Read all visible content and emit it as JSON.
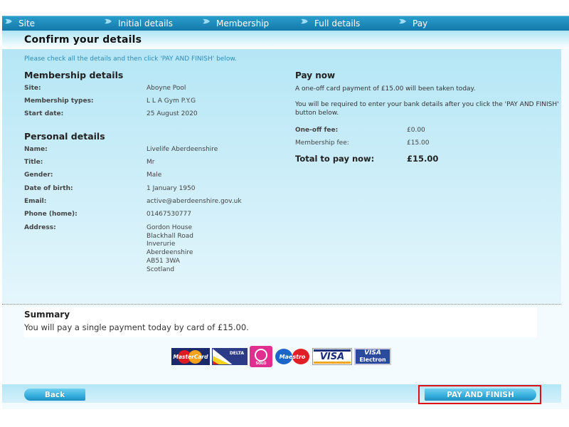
{
  "nav": {
    "steps": [
      {
        "label": "Site",
        "icon": "arrow-icon"
      },
      {
        "label": "Initial details",
        "icon": "arrow-icon"
      },
      {
        "label": "Membership",
        "icon": "arrow-icon"
      },
      {
        "label": "Full details",
        "icon": "arrow-icon"
      },
      {
        "label": "Pay",
        "icon": "arrow-icon"
      }
    ]
  },
  "page": {
    "title": "Confirm your details",
    "instruction": "Please check all the details and then click 'PAY AND FINISH' below."
  },
  "membership": {
    "heading": "Membership details",
    "rows": [
      {
        "label": "Site:",
        "value": "Aboyne Pool"
      },
      {
        "label": "Membership types:",
        "value": "L L A Gym P.Y.G"
      },
      {
        "label": "Start date:",
        "value": "25 August 2020"
      }
    ]
  },
  "personal": {
    "heading": "Personal details",
    "rows": [
      {
        "label": "Name:",
        "value": "Livelife Aberdeenshire"
      },
      {
        "label": "Title:",
        "value": "Mr"
      },
      {
        "label": "Gender:",
        "value": "Male"
      },
      {
        "label": "Date of birth:",
        "value": "1 January 1950"
      },
      {
        "label": "Email:",
        "value": "active@aberdeenshire.gov.uk"
      },
      {
        "label": "Phone (home):",
        "value": "01467530777"
      }
    ],
    "address_label": "Address:",
    "address_lines": [
      "Gordon House",
      "Blackhall Road",
      "Inverurie",
      "Aberdeenshire",
      "AB51 3WA",
      "Scotland"
    ]
  },
  "pay_now": {
    "heading": "Pay now",
    "text1": "A one-off card payment of £15.00 will been taken today.",
    "text2": "You will be required to enter your bank details after you click the 'PAY AND FINISH' button below.",
    "fees": [
      {
        "label": "One-off fee:",
        "value": "£0.00"
      },
      {
        "label": "Membership fee:",
        "value": "£15.00"
      }
    ],
    "total_label": "Total to pay now:",
    "total_value": "£15.00"
  },
  "summary": {
    "heading": "Summary",
    "text": "You will pay a single payment today by card of £15.00."
  },
  "cards": [
    {
      "name": "MasterCard",
      "icon": "mastercard-logo"
    },
    {
      "name": "DELTA",
      "icon": "delta-logo"
    },
    {
      "name": "SOLO",
      "icon": "solo-logo"
    },
    {
      "name": "Maestro",
      "icon": "maestro-logo"
    },
    {
      "name": "VISA",
      "icon": "visa-logo"
    },
    {
      "name": "VISA Electron",
      "line1": "VISA",
      "line2": "Electron",
      "icon": "visa-electron-logo"
    }
  ],
  "buttons": {
    "back": "Back",
    "pay_and_finish": "PAY AND FINISH"
  },
  "colors": {
    "nav": "#1a86b8",
    "panel": "#b5e6f5",
    "button": "#3ab1e0",
    "highlight": "#dd1111",
    "instruction_text": "#2e8ab8"
  }
}
